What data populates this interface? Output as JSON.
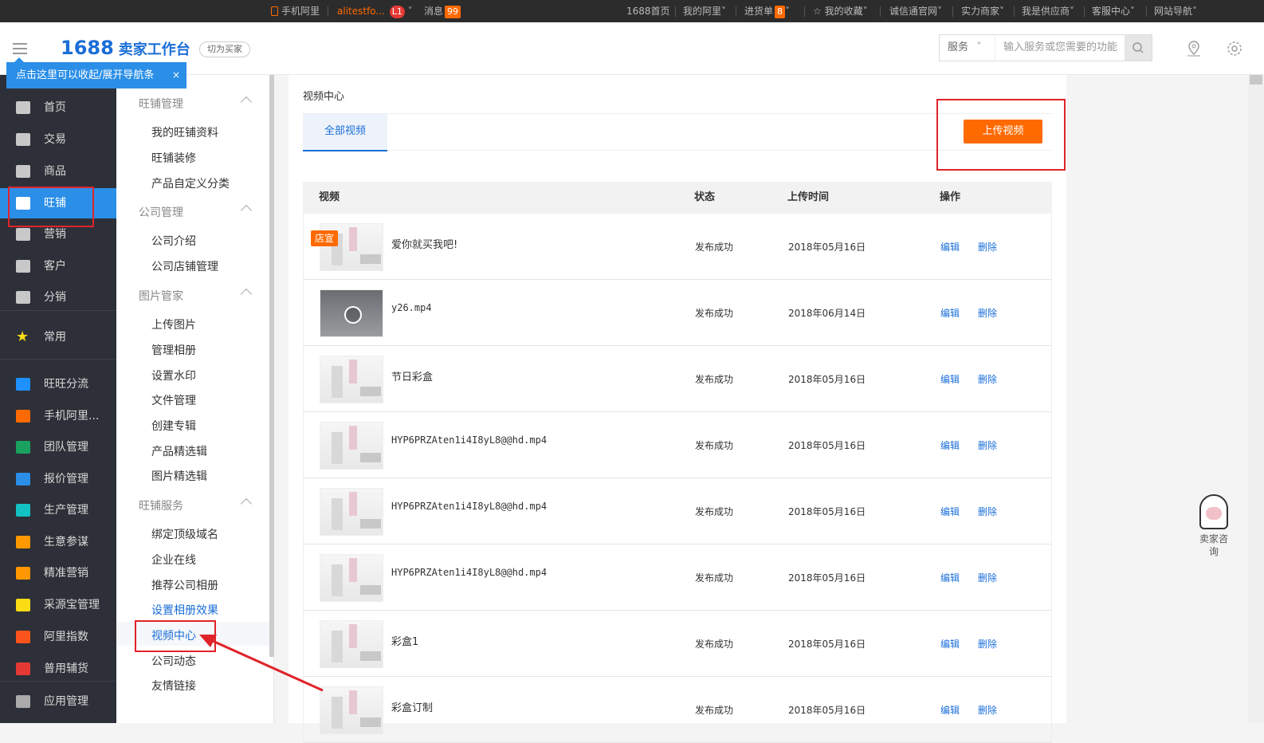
{
  "topbar": {
    "mobile": "手机阿里",
    "user": "alitestfo...",
    "user_level": "L1",
    "messages_label": "消息",
    "messages_count": "99",
    "home": "1688首页",
    "my_ali": "我的阿里",
    "purchase": "进货单",
    "purchase_count": "8",
    "favorites": "我的收藏",
    "chengxin": "诚信通官网",
    "shili": "实力商家",
    "supplier": "我是供应商",
    "service_center": "客服中心",
    "site_nav": "网站导航"
  },
  "header": {
    "logo_num": "1688",
    "logo_text": "卖家工作台",
    "switch_label": "切为买家",
    "tooltip": "点击这里可以收起/展开导航条",
    "tooltip_close": "×",
    "search_select": "服务",
    "search_placeholder": "输入服务或您需要的功能"
  },
  "leftnav": {
    "items": [
      {
        "label": "首页",
        "icon": "home-icon"
      },
      {
        "label": "交易",
        "icon": "clipboard-icon"
      },
      {
        "label": "商品",
        "icon": "bag-icon"
      },
      {
        "label": "旺铺",
        "icon": "store-icon"
      },
      {
        "label": "营销",
        "icon": "tag-icon"
      },
      {
        "label": "客户",
        "icon": "user-icon"
      },
      {
        "label": "分销",
        "icon": "share-icon"
      },
      {
        "label": "常用",
        "icon": "star-icon"
      },
      {
        "label": "旺旺分流",
        "icon": "wangwang-icon"
      },
      {
        "label": "手机阿里...",
        "icon": "mobile-ali-icon"
      },
      {
        "label": "团队管理",
        "icon": "team-icon"
      },
      {
        "label": "报价管理",
        "icon": "quote-icon"
      },
      {
        "label": "生产管理",
        "icon": "production-icon"
      },
      {
        "label": "生意参谋",
        "icon": "business-icon"
      },
      {
        "label": "精准营销",
        "icon": "target-icon"
      },
      {
        "label": "采源宝管理",
        "icon": "caiyuanbao-icon"
      },
      {
        "label": "阿里指数",
        "icon": "index-icon"
      },
      {
        "label": "普用辅货",
        "icon": "goods-icon"
      },
      {
        "label": "应用管理",
        "icon": "apps-icon"
      }
    ],
    "icon_colors": [
      "#1e90ff",
      "#ff6a00",
      "#19a15f",
      "#2b8fe8",
      "#13c2c2",
      "#ff9800",
      "#ff9800",
      "#fadb14",
      "#fa541c",
      "#e53935"
    ]
  },
  "subnav": {
    "groups": [
      {
        "title": "旺铺管理",
        "items": [
          "我的旺铺资料",
          "旺铺装修",
          "产品自定义分类"
        ]
      },
      {
        "title": "公司管理",
        "items": [
          "公司介绍",
          "公司店铺管理"
        ]
      },
      {
        "title": "图片管家",
        "items": [
          "上传图片",
          "管理相册",
          "设置水印",
          "文件管理",
          "创建专辑",
          "产品精选辑",
          "图片精选辑"
        ]
      },
      {
        "title": "旺铺服务",
        "items": [
          "绑定顶级域名",
          "企业在线",
          "推荐公司相册",
          "设置相册效果",
          "视频中心",
          "公司动态",
          "友情链接"
        ]
      }
    ]
  },
  "main": {
    "breadcrumb": "视频中心",
    "tab_all": "全部视频",
    "upload_button": "上传视频",
    "columns": {
      "video": "视频",
      "status": "状态",
      "time": "上传时间",
      "ops": "操作"
    },
    "edit": "编辑",
    "delete": "删除",
    "rows": [
      {
        "name": "爱你就买我吧!",
        "tag": "店宣",
        "status": "发布成功",
        "time": "2018年05月16日",
        "dark": false
      },
      {
        "name": "y26.mp4",
        "tag": "",
        "status": "发布成功",
        "time": "2018年06月14日",
        "dark": true
      },
      {
        "name": "节日彩盒",
        "tag": "",
        "status": "发布成功",
        "time": "2018年05月16日",
        "dark": false
      },
      {
        "name": "HYP6PRZAten1i4I8yL8@@hd.mp4",
        "tag": "",
        "status": "发布成功",
        "time": "2018年05月16日",
        "dark": false
      },
      {
        "name": "HYP6PRZAten1i4I8yL8@@hd.mp4",
        "tag": "",
        "status": "发布成功",
        "time": "2018年05月16日",
        "dark": false
      },
      {
        "name": "HYP6PRZAten1i4I8yL8@@hd.mp4",
        "tag": "",
        "status": "发布成功",
        "time": "2018年05月16日",
        "dark": false
      },
      {
        "name": "彩盒1",
        "tag": "",
        "status": "发布成功",
        "time": "2018年05月16日",
        "dark": false
      },
      {
        "name": "彩盒订制",
        "tag": "",
        "status": "发布成功",
        "time": "2018年05月16日",
        "dark": false
      }
    ]
  },
  "consult": {
    "label": "卖家咨询"
  }
}
